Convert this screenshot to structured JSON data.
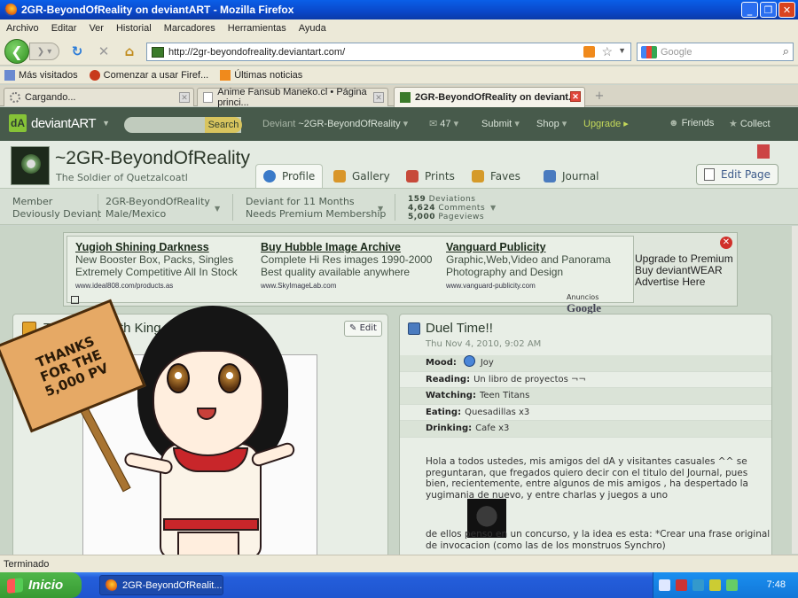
{
  "window": {
    "title": "2GR-BeyondOfReality on deviantART - Mozilla Firefox",
    "min": "_",
    "max": "❐",
    "close": "✕"
  },
  "menu": [
    "Archivo",
    "Editar",
    "Ver",
    "Historial",
    "Marcadores",
    "Herramientas",
    "Ayuda"
  ],
  "nav": {
    "url": "http://2gr-beyondofreality.deviantart.com/",
    "search_placeholder": "Google"
  },
  "bookmarks": [
    "Más visitados",
    "Comenzar a usar Firef...",
    "Últimas noticias"
  ],
  "tabs": [
    {
      "label": "Cargando..."
    },
    {
      "label": "Anime Fansub Maneko.cl • Página princi..."
    },
    {
      "label": "2GR-BeyondOfReality on deviant..."
    }
  ],
  "da": {
    "logo_text": "deviantART",
    "search_btn": "Search",
    "deviant_prefix": "Deviant",
    "deviant_name": "~2GR-BeyondOfReality",
    "messages": "47",
    "submit": "Submit",
    "shop": "Shop",
    "upgrade": "Upgrade",
    "friends": "Friends",
    "collect": "Collect"
  },
  "profile": {
    "username": "~2GR-BeyondOfReality",
    "tagline": "The Soldier of Quetzalcoatl",
    "tabs": [
      "Profile",
      "Gallery",
      "Prints",
      "Faves",
      "Journal"
    ],
    "edit_page": "Edit Page"
  },
  "stats": {
    "member": "Member",
    "member_type": "Deviously Deviant",
    "name": "2GR-BeyondOfReality",
    "location": "Male/Mexico",
    "deviant_for": "Deviant for 11 Months",
    "premium": "Needs Premium Membership",
    "deviations_n": "159",
    "deviations_l": "Deviations",
    "comments_n": "4,624",
    "comments_l": "Comments",
    "pageviews_n": "5,000",
    "pageviews_l": "Pageviews"
  },
  "ads": [
    {
      "title": "Yugioh Shining Darkness",
      "line1": "New Booster Box, Packs, Singles",
      "line2": "Extremely Competitive All In Stock",
      "url": "www.ideal808.com/products.as"
    },
    {
      "title": "Buy Hubble Image Archive",
      "line1": "Complete Hi Res images 1990-2000",
      "line2": "Best quality available anywhere",
      "url": "www.SkyImageLab.com"
    },
    {
      "title": "Vanguard Publicity",
      "line1": "Graphic,Web,Video and Panorama",
      "line2": "Photography and Design",
      "url": "www.vanguard-publicity.com"
    }
  ],
  "ads_label": "Anuncios",
  "ads_brand": "Google",
  "upgrade_ad": [
    "Upgrade to Premium",
    "Buy deviantWEAR",
    "Advertise Here"
  ],
  "left_panel": {
    "title": "The Aerobnoth King",
    "edit": "✎ Edit"
  },
  "sign": [
    "THANKS",
    "FOR THE",
    "5,000 PV"
  ],
  "journal": {
    "title": "Duel Time!!",
    "date": "Thu Nov 4, 2010, 9:02 AM",
    "rows": [
      {
        "label": "Mood:",
        "value": "Joy"
      },
      {
        "label": "Reading:",
        "value": "Un libro de proyectos ¬¬"
      },
      {
        "label": "Watching:",
        "value": "Teen Titans"
      },
      {
        "label": "Eating:",
        "value": "Quesadillas x3"
      },
      {
        "label": "Drinking:",
        "value": "Cafe x3"
      }
    ],
    "body": "Hola a todos ustedes, mis amigos del dA y visitantes casuales ^^ se preguntaran, que fregados quiero decir con el titulo del Journal, pues bien, recientemente, entre algunos de mis amigos , ha despertado la yugimania de nuevo, y entre charlas y juegos a uno",
    "body2": "de ellos                penso en un concurso, y la idea es esta: *Crear una frase original de invocacion (como las de los monstruos Synchro)"
  },
  "status": "Terminado",
  "taskbar": {
    "start": "Inicio",
    "task": "2GR-BeyondOfRealit...",
    "clock": "7:48"
  }
}
